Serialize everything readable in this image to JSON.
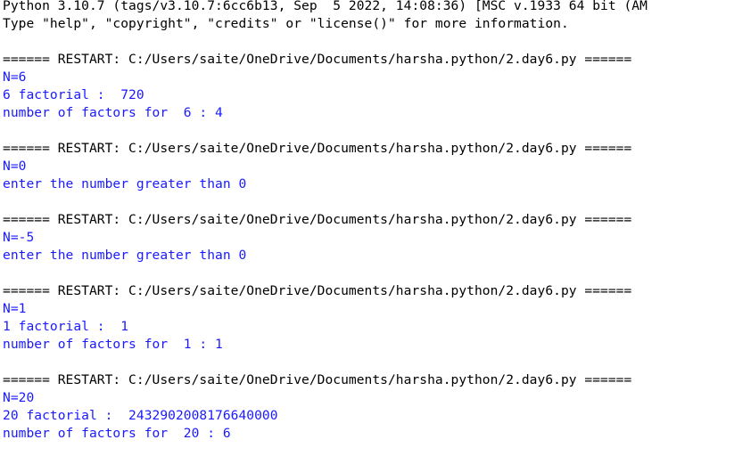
{
  "header": {
    "banner_line1": "Python 3.10.7 (tags/v3.10.7:6cc6b13, Sep  5 2022, 14:08:36) [MSC v.1933 64 bit (AM",
    "banner_line2": "Type \"help\", \"copyright\", \"credits\" or \"license()\" for more information."
  },
  "runs": [
    {
      "restart": "====== RESTART: C:/Users/saite/OneDrive/Documents/harsha.python/2.day6.py ======",
      "input_line": "N=6",
      "outputs": [
        "6 factorial :  720",
        "number of factors for  6 : 4"
      ]
    },
    {
      "restart": "====== RESTART: C:/Users/saite/OneDrive/Documents/harsha.python/2.day6.py ======",
      "input_line": "N=0",
      "outputs": [
        "enter the number greater than 0"
      ]
    },
    {
      "restart": "====== RESTART: C:/Users/saite/OneDrive/Documents/harsha.python/2.day6.py ======",
      "input_line": "N=-5",
      "outputs": [
        "enter the number greater than 0"
      ]
    },
    {
      "restart": "====== RESTART: C:/Users/saite/OneDrive/Documents/harsha.python/2.day6.py ======",
      "input_line": "N=1",
      "outputs": [
        "1 factorial :  1",
        "number of factors for  1 : 1"
      ]
    },
    {
      "restart": "====== RESTART: C:/Users/saite/OneDrive/Documents/harsha.python/2.day6.py ======",
      "input_line": "N=20",
      "outputs": [
        "20 factorial :  2432902008176640000",
        "number of factors for  20 : 6"
      ]
    }
  ],
  "colors": {
    "background": "#ffffff",
    "stdout_text": "#000000",
    "program_output_text": "#1a1aff"
  }
}
